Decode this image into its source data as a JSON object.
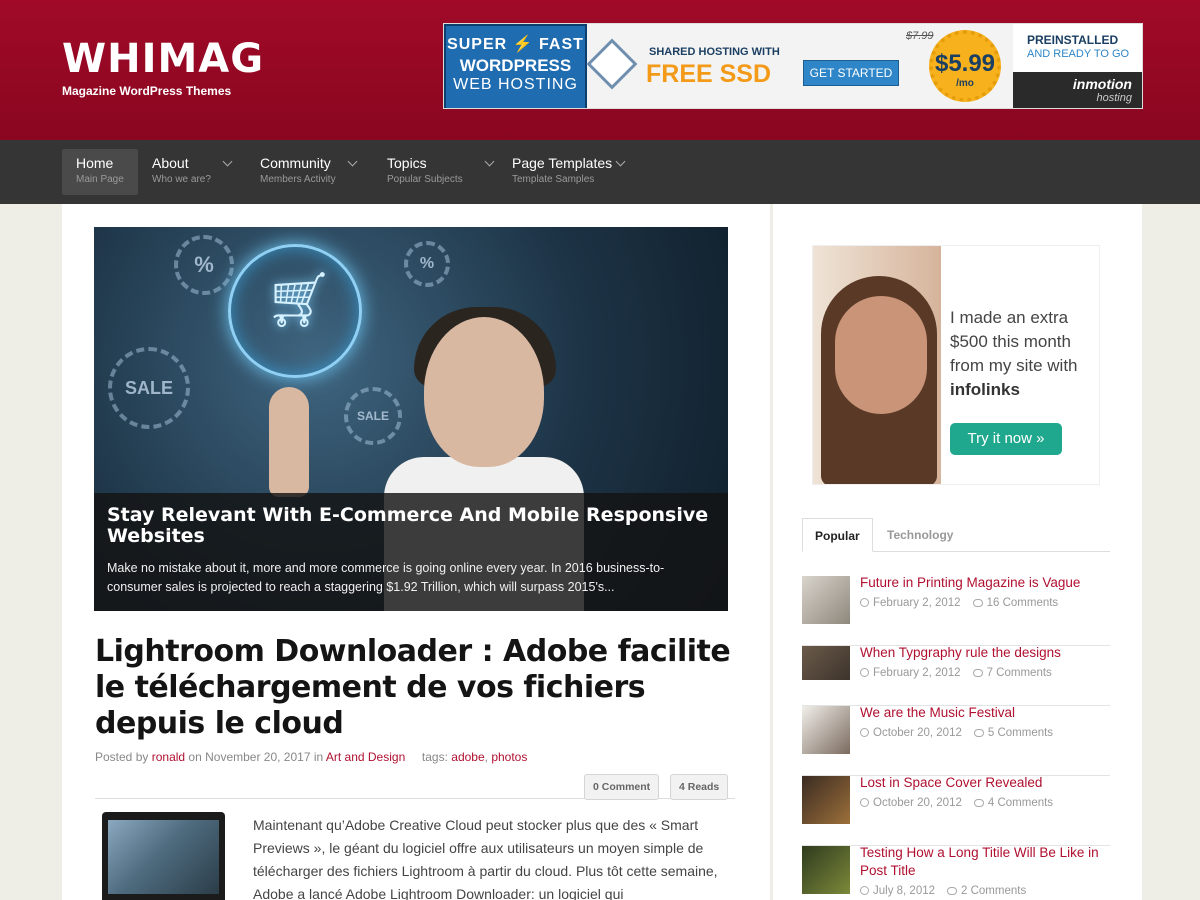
{
  "header": {
    "site_title": "WHIMAG",
    "tagline": "Magazine WordPress Themes",
    "banner": {
      "left_line1": "SUPER",
      "left_line1b": "FAST",
      "left_line2": "WORDPRESS",
      "left_line3": "WEB HOSTING",
      "shared": "SHARED HOSTING WITH",
      "free_ssd": "FREE SSD",
      "cta": "GET STARTED",
      "old_price": "$7.99",
      "price": "$5.99",
      "per": "/mo",
      "preinstalled": "PREINSTALLED",
      "ready": "AND READY TO GO",
      "brand": "inmotion",
      "brand_sub": "hosting"
    }
  },
  "nav": [
    {
      "title": "Home",
      "sub": "Main Page"
    },
    {
      "title": "About",
      "sub": "Who we are?"
    },
    {
      "title": "Community",
      "sub": "Members Activity"
    },
    {
      "title": "Topics",
      "sub": "Popular Subjects"
    },
    {
      "title": "Page Templates",
      "sub": "Template Samples"
    }
  ],
  "featured": {
    "sale1": "SALE",
    "sale2": "SALE",
    "pct": "%",
    "title": "Stay Relevant With E-Commerce And Mobile Responsive Websites",
    "excerpt": "Make no mistake about it, more and more commerce is going online every year. In 2016 business-to-consumer sales is projected to reach a staggering $1.92 Trillion, which will surpass 2015's..."
  },
  "post": {
    "title": "Lightroom Downloader : Adobe facilite le téléchargement de vos fichiers depuis le cloud",
    "meta_posted": "Posted by",
    "author": "ronald",
    "meta_on": "on November 20, 2017 in",
    "category": "Art and Design",
    "meta_tags": "tags:",
    "tag1": "adobe",
    "tag2": "photos",
    "comments": "0 Comment",
    "reads": "4 Reads",
    "excerpt": "Maintenant qu’Adobe Creative Cloud peut stocker plus que des « Smart Previews », le géant du logiciel offre aux utilisateurs un moyen simple de télécharger des fichiers Lightroom à partir du cloud. Plus tôt cette semaine, Adobe a lancé Adobe Lightroom Downloader: un logiciel qui"
  },
  "sidebar": {
    "ad": {
      "text": "I made an extra $500 this month from my site with",
      "brand": "infolinks",
      "cta": "Try it now »"
    },
    "tabs": [
      "Popular",
      "Technology"
    ],
    "items": [
      {
        "title": "Future in Printing Magazine is Vague",
        "date": "February 2, 2012",
        "comments": "16 Comments"
      },
      {
        "title": "When Typgraphy rule the designs",
        "date": "February 2, 2012",
        "comments": "7 Comments"
      },
      {
        "title": "We are the Music Festival",
        "date": "October 20, 2012",
        "comments": "5 Comments"
      },
      {
        "title": "Lost in Space Cover Revealed",
        "date": "October 20, 2012",
        "comments": "4 Comments"
      },
      {
        "title": "Testing How a Long Titile Will Be Like in Post Title",
        "date": "July 8, 2012",
        "comments": "2 Comments"
      }
    ]
  },
  "colors": {
    "header_red": "#a00a28",
    "nav_dark": "#353535",
    "link_red": "#b01030",
    "cta_green": "#20a88e"
  }
}
